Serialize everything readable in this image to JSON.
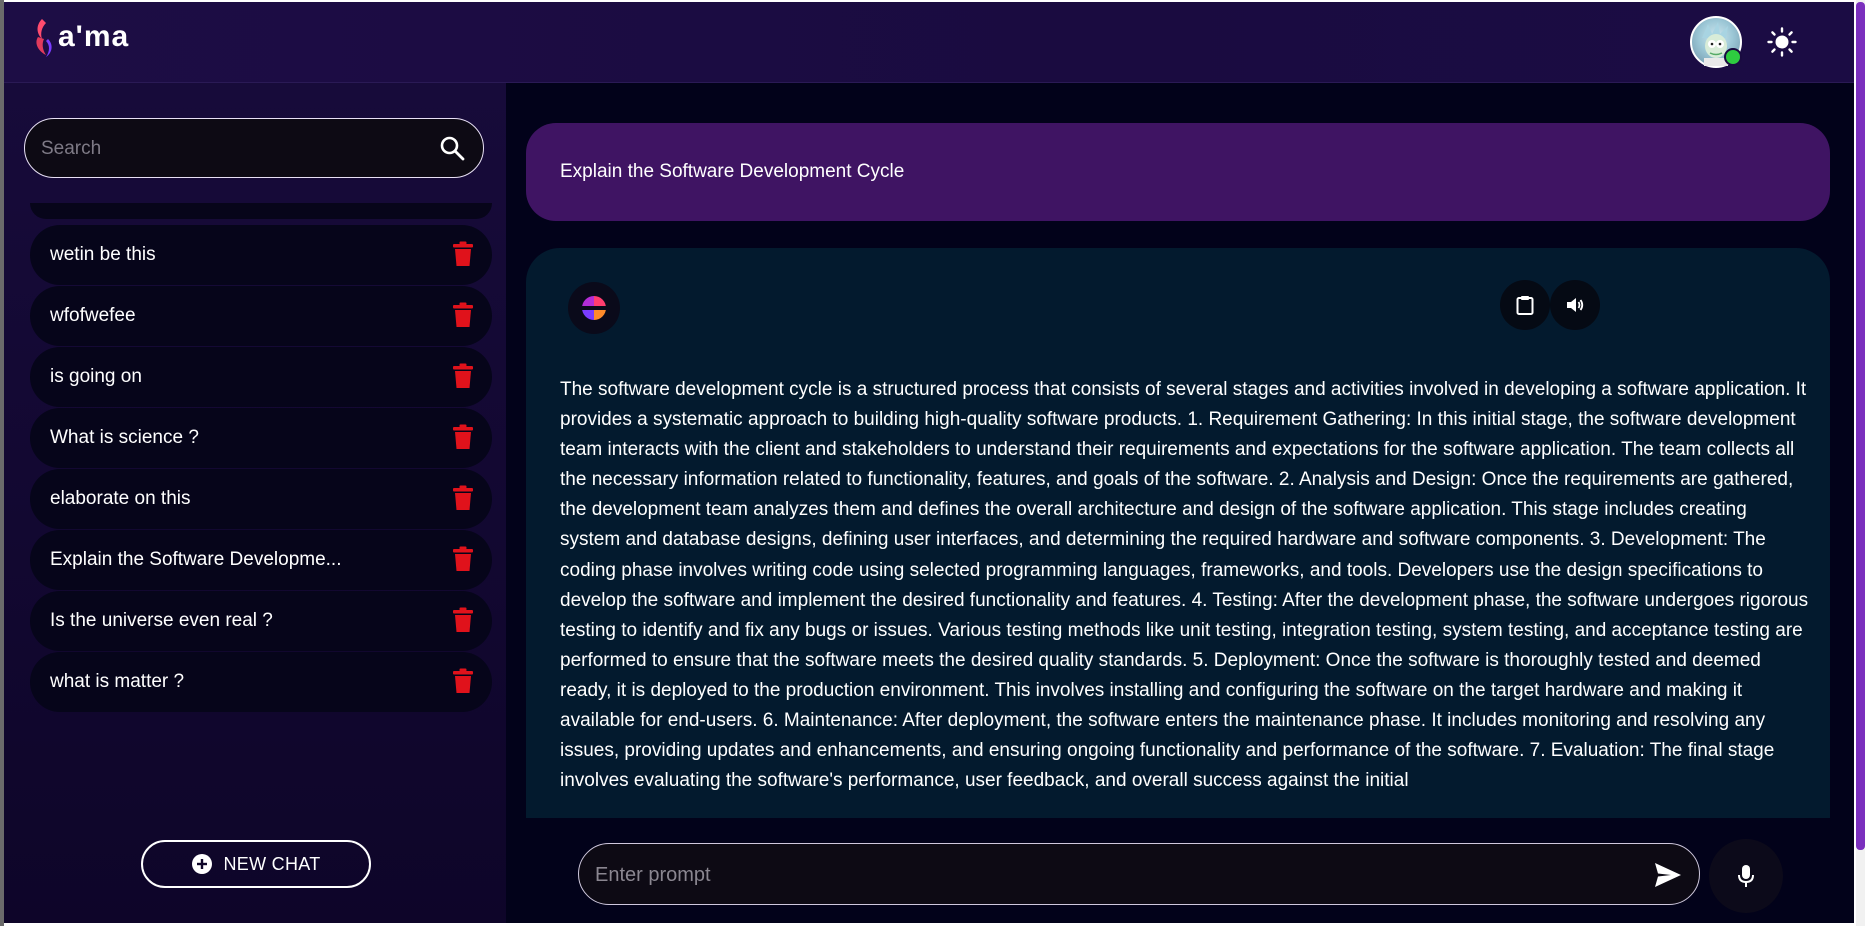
{
  "header": {
    "logo_text": "a'ma",
    "avatar_alt": "user avatar",
    "theme_toggle": "light-mode"
  },
  "sidebar": {
    "search": {
      "placeholder": "Search",
      "value": ""
    },
    "chats": [
      {
        "label": "wetin be this"
      },
      {
        "label": "wfofwefee"
      },
      {
        "label": "is going on"
      },
      {
        "label": "What is science ?"
      },
      {
        "label": "elaborate on this"
      },
      {
        "label": "Explain the Software Developme..."
      },
      {
        "label": "Is the universe even real ?"
      },
      {
        "label": "what is matter ?"
      }
    ],
    "new_chat_label": "NEW CHAT"
  },
  "conversation": {
    "user_message": "Explain the Software Development Cycle",
    "bot_message": "The software development cycle is a structured process that consists of several stages and activities involved in developing a software application. It provides a systematic approach to building high-quality software products. 1. Requirement Gathering: In this initial stage, the software development team interacts with the client and stakeholders to understand their requirements and expectations for the software application. The team collects all the necessary information related to functionality, features, and goals of the software. 2. Analysis and Design: Once the requirements are gathered, the development team analyzes them and defines the overall architecture and design of the software application. This stage includes creating system and database designs, defining user interfaces, and determining the required hardware and software components. 3. Development: The coding phase involves writing code using selected programming languages, frameworks, and tools. Developers use the design specifications to develop the software and implement the desired functionality and features. 4. Testing: After the development phase, the software undergoes rigorous testing to identify and fix any bugs or issues. Various testing methods like unit testing, integration testing, system testing, and acceptance testing are performed to ensure that the software meets the desired quality standards. 5. Deployment: Once the software is thoroughly tested and deemed ready, it is deployed to the production environment. This involves installing and configuring the software on the target hardware and making it available for end-users. 6. Maintenance: After deployment, the software enters the maintenance phase. It includes monitoring and resolving any issues, providing updates and enhancements, and ensuring ongoing functionality and performance of the software. 7. Evaluation: The final stage involves evaluating the software's performance, user feedback, and overall success against the initial"
  },
  "composer": {
    "placeholder": "Enter prompt",
    "value": ""
  },
  "colors": {
    "user_bubble": "#3f1463",
    "bot_bubble": "#031a2e",
    "delete_icon": "#e0121b",
    "scrollbar": "#7b2fbe"
  }
}
